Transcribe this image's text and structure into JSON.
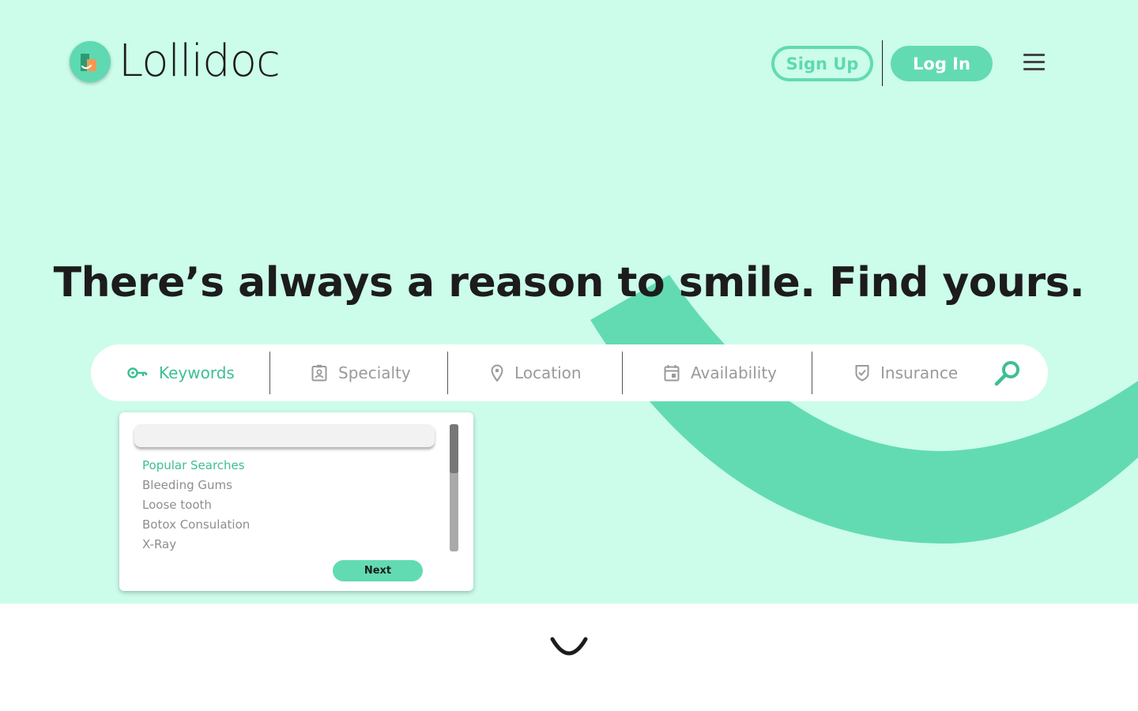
{
  "brand": {
    "name": "Lollidoc",
    "colors": {
      "accent": "#62dbb3",
      "hero_bg": "#ccfcea",
      "arc": "#62dbb3",
      "text": "#1c1c1c"
    }
  },
  "header": {
    "signup_label": "Sign Up",
    "login_label": "Log In",
    "menu_icon": "hamburger-icon"
  },
  "hero": {
    "headline": "There’s always a reason to smile. Find yours."
  },
  "search": {
    "fields": [
      {
        "label": "Keywords",
        "icon": "key-icon",
        "active": true
      },
      {
        "label": "Specialty",
        "icon": "id-badge-icon",
        "active": false
      },
      {
        "label": "Location",
        "icon": "map-pin-icon",
        "active": false
      },
      {
        "label": "Availability",
        "icon": "calendar-icon",
        "active": false
      },
      {
        "label": "Insurance",
        "icon": "shield-check-icon",
        "active": false
      }
    ],
    "submit_icon": "search-icon"
  },
  "dropdown": {
    "input_value": "",
    "heading": "Popular Searches",
    "items": [
      "Bleeding Gums",
      "Loose tooth",
      "Botox Consulation",
      "X-Ray"
    ],
    "next_label": "Next"
  }
}
